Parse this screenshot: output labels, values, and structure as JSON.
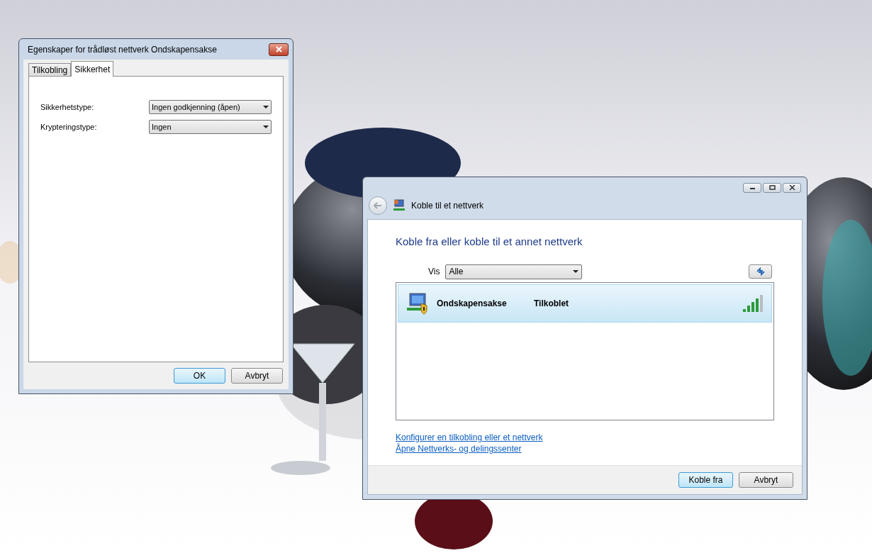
{
  "properties_dialog": {
    "title": "Egenskaper for trådløst nettverk Ondskapensakse",
    "tabs": [
      {
        "label": "Tilkobling",
        "selected": false
      },
      {
        "label": "Sikkerhet",
        "selected": true
      }
    ],
    "fields": [
      {
        "label": "Sikkerhetstype:",
        "value": "Ingen godkjenning (åpen)"
      },
      {
        "label": "Krypteringstype:",
        "value": "Ingen"
      }
    ],
    "buttons": [
      {
        "label": "OK",
        "default": true
      },
      {
        "label": "Avbryt",
        "default": false
      }
    ]
  },
  "connect_window": {
    "title": "Koble til et nettverk",
    "heading": "Koble fra eller koble til et annet nettverk",
    "filter": {
      "label": "Vis",
      "value": "Alle"
    },
    "networks": [
      {
        "name": "Ondskapensakse",
        "status": "Tilkoblet",
        "selected": true
      }
    ],
    "links": [
      "Konfigurer en tilkobling eller et nettverk",
      "Åpne Nettverks- og delingssenter"
    ],
    "buttons": [
      {
        "label": "Koble fra",
        "default": true
      },
      {
        "label": "Avbryt",
        "default": false
      }
    ]
  }
}
